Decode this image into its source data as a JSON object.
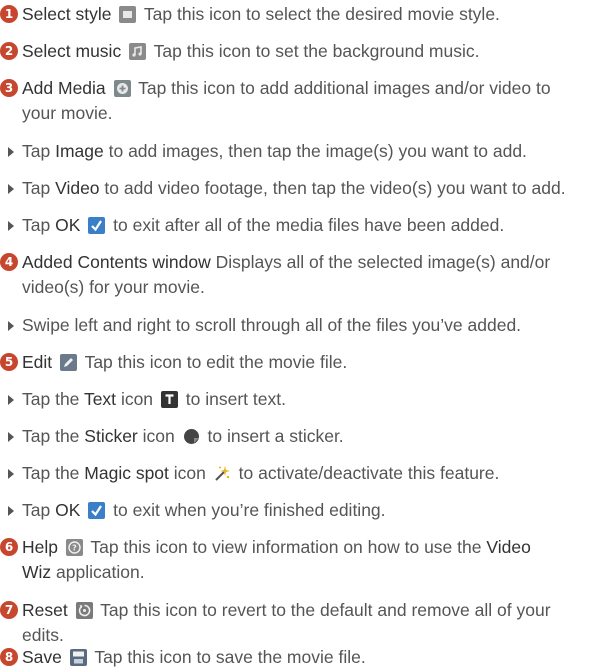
{
  "items": [
    {
      "num": "1",
      "term": "Select style",
      "desc": "Tap this icon to select the desired movie style."
    },
    {
      "num": "2",
      "term": "Select music",
      "desc": "Tap this icon to set the background music."
    },
    {
      "num": "3",
      "term": "Add Media",
      "desc1": "Tap this icon to add additional images and/or video to",
      "desc2": "your movie."
    },
    {
      "pre": "Tap",
      "term": "Image",
      "post": "to add images, then tap the image(s) you want to add."
    },
    {
      "pre": "Tap",
      "term": "Video",
      "post": "to add video footage, then tap the video(s) you want to add."
    },
    {
      "pre": "Tap",
      "term": "OK",
      "post": "to exit after all of the media files have been added."
    },
    {
      "num": "4",
      "term": "Added Contents window",
      "desc1": "Displays all of the selected image(s) and/or",
      "desc2": "video(s) for your movie."
    },
    {
      "text": "Swipe left and right to scroll through all of the files you’ve added."
    },
    {
      "num": "5",
      "term": "Edit",
      "desc": "Tap this icon to edit the movie file."
    },
    {
      "pre": "Tap the",
      "term": "Text",
      "mid": "icon",
      "post": "to insert text."
    },
    {
      "pre": "Tap the",
      "term": "Sticker",
      "mid": "icon",
      "post": "to insert a sticker."
    },
    {
      "pre": "Tap the",
      "term": "Magic spot",
      "mid": "icon",
      "post": "to activate/deactivate this feature."
    },
    {
      "pre": "Tap",
      "term": "OK",
      "post": "to exit when you’re finished editing."
    },
    {
      "num": "6",
      "term": "Help",
      "desc1a": "Tap this icon to view information on how to use the",
      "term2a": "Video",
      "term2b": "Wiz",
      "desc2": "application."
    },
    {
      "num": "7",
      "term": "Reset",
      "desc1": "Tap this icon to revert to the default and remove all of your",
      "desc2": "edits."
    },
    {
      "num": "8",
      "term": "Save",
      "desc": "Tap this icon to save the movie file."
    }
  ]
}
